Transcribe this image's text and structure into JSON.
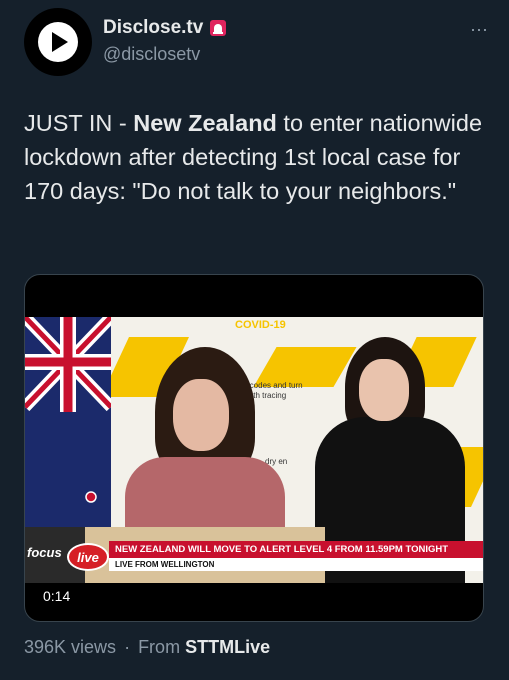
{
  "author": {
    "display_name": "Disclose.tv",
    "handle": "@disclosetv",
    "badge_icon": "siren-icon",
    "avatar_icon": "play-arrow-icon"
  },
  "more_icon": "⋯",
  "tweet": {
    "text_before": "JUST IN - ",
    "text_bold": "New Zealand",
    "text_after": " to enter nationwide lockdown after detecting 1st local case for 170 days: \"Do not talk to your neighbors.\""
  },
  "video": {
    "sign_title": "COVID-19",
    "sign_text": "Scan QR codes and turn on Bluetooth tracing",
    "sign_text2": "dry en",
    "channel_small": "nzherald",
    "channel_name": "focus",
    "live_label": "live",
    "headline": "NEW ZEALAND WILL MOVE TO ALERT LEVEL 4 FROM 11.59PM TONIGHT",
    "subline": "LIVE FROM WELLINGTON",
    "timestamp": "0:14"
  },
  "stats": {
    "views": "396K views",
    "separator": "·",
    "from_label": "From",
    "source": "STTMLive"
  }
}
